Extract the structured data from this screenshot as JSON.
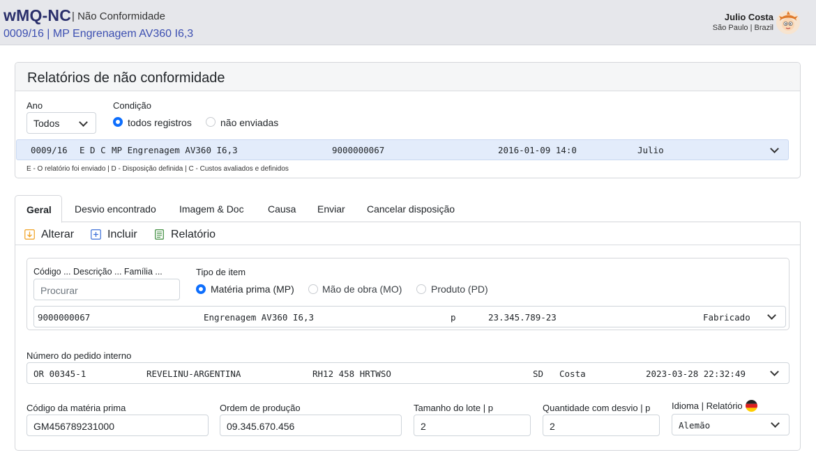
{
  "header": {
    "app_name": "wMQ-NC",
    "app_section": "| Não Conformidade",
    "record": "0009/16 | MP Engrenagem AV360 I6,3",
    "user_name": "Julio Costa",
    "user_location": "São Paulo | Brazil"
  },
  "reports": {
    "title": "Relatórios de não conformidade",
    "year_label": "Ano",
    "year_value": "Todos",
    "condition_label": "Condição",
    "condition_options": [
      "todos registros",
      "não enviadas"
    ],
    "condition_selected": "todos registros",
    "selected_row": {
      "id": "0009/16",
      "flags": "E D C",
      "desc": "MP Engrenagem AV360 I6,3",
      "code": "9000000067",
      "datetime": "2016-01-09 14:0",
      "user": "Julio"
    },
    "legend": "E - O relatório foi enviado | D - Disposição definida | C - Custos avaliados e definidos"
  },
  "tabs": [
    "Geral",
    "Desvio encontrado",
    "Imagem & Doc",
    "Causa",
    "Enviar",
    "Cancelar disposição"
  ],
  "active_tab": "Geral",
  "toolbar": {
    "alter": "Alterar",
    "include": "Incluir",
    "report": "Relatório"
  },
  "item": {
    "search_label": "Código ... Descrição ... Família ...",
    "search_placeholder": "Procurar",
    "type_label": "Tipo de item",
    "type_options": [
      "Matéria prima (MP)",
      "Mão de obra (MO)",
      "Produto (PD)"
    ],
    "type_selected": "Matéria prima (MP)",
    "row": {
      "code": "9000000067",
      "desc": "Engrenagem AV360 I6,3",
      "unit": "p",
      "ref": "23.345.789-23",
      "status": "Fabricado"
    }
  },
  "order": {
    "label": "Número do pedido interno",
    "row": {
      "order": "OR 00345-1",
      "client": "REVELINU-ARGENTINA",
      "ref": "RH12 458 HRTWSO",
      "code": "SD",
      "user": "Costa",
      "datetime": "2023-03-28 22:32:49"
    }
  },
  "fields": {
    "raw_code_label": "Código da matéria prima",
    "raw_code_value": "GM456789231000",
    "prod_order_label": "Ordem de produção",
    "prod_order_value": "09.345.670.456",
    "lot_label": "Tamanho do lote | p",
    "lot_value": "2",
    "dev_qty_label": "Quantidade com desvio | p",
    "dev_qty_value": "2",
    "lang_label": "Idioma | Relatório",
    "lang_value": "Alemão"
  },
  "colors": {
    "brand": "#2a2f6b",
    "link": "#3c4fb1",
    "accent": "#0d6efd",
    "selected_row_bg": "#e3ecfb",
    "toolbar_icon_alter": "#f0a020",
    "toolbar_icon_include": "#3b6fd8",
    "toolbar_icon_report": "#3a8a3a"
  }
}
